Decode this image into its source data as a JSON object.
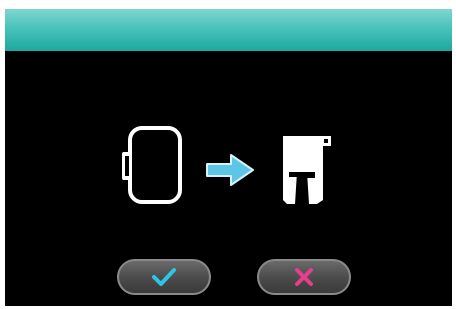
{
  "header": {
    "color_top": "#7fd6d0",
    "color_bottom": "#1fa79f"
  },
  "illustration": {
    "icons": [
      "embroidery-hoop-icon",
      "arrow-right-icon",
      "presser-foot-icon"
    ],
    "arrow_color": "#5cc6e6",
    "icon_color": "#ffffff"
  },
  "buttons": {
    "ok": {
      "icon": "checkmark-icon",
      "color": "#2ec4e6"
    },
    "cancel": {
      "icon": "cross-icon",
      "color": "#e83e8c"
    }
  }
}
